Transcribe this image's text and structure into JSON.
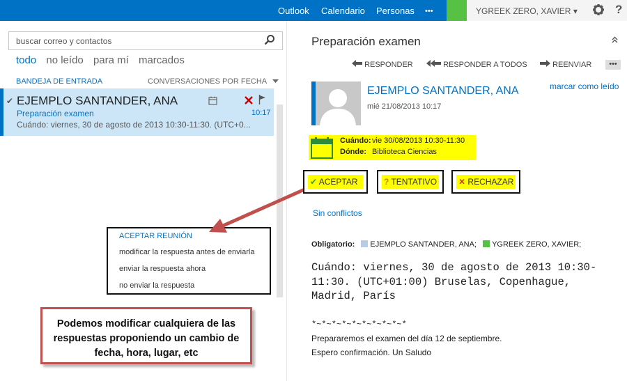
{
  "topbar": {
    "nav": [
      "Outlook",
      "Calendario",
      "Personas"
    ],
    "more": "•••",
    "user": "YGREEK ZERO, XAVIER",
    "user_caret": "▾",
    "icons": [
      "gear-icon",
      "help-icon"
    ],
    "help": "?"
  },
  "search": {
    "placeholder": "buscar correo y contactos"
  },
  "filters": [
    "todo",
    "no leído",
    "para mí",
    "marcados"
  ],
  "folder": {
    "name": "BANDEJA DE ENTRADA",
    "sort": "CONVERSACIONES POR FECHA"
  },
  "message": {
    "sender": "EJEMPLO SANTANDER, ANA",
    "subject": "Preparación examen",
    "preview": "Cuándo: viernes, 30 de agosto de 2013 10:30-11:30. (UTC+0...",
    "time": "10:17"
  },
  "popup": {
    "header": "ACEPTAR REUNIÓN",
    "items": [
      "modificar la respuesta antes de enviarla",
      "enviar la respuesta ahora",
      "no enviar la respuesta"
    ]
  },
  "callout": {
    "lines": [
      "Podemos modificar cualquiera de las",
      "respuestas proponiendo un cambio de",
      "fecha, hora, lugar, etc"
    ]
  },
  "reading": {
    "title": "Preparación examen",
    "actions": [
      "RESPONDER",
      "RESPONDER A TODOS",
      "REENVIAR"
    ],
    "more": "•••",
    "sender": "EJEMPLO SANTANDER, ANA",
    "date": "mié 21/08/2013 10:17",
    "mark_read": "marcar como leído",
    "when_label": "Cuándo:",
    "when_value": "vie 30/08/2013 10:30-11:30",
    "where_label": "Dónde:",
    "where_value": "Biblioteca Ciencias",
    "responses": [
      "ACEPTAR",
      "TENTATIVO",
      "RECHAZAR"
    ],
    "no_conflicts": "Sin conflictos",
    "required_label": "Obligatorio:",
    "attendees": [
      {
        "name": "EJEMPLO SANTANDER, ANA;",
        "color": "#b8cce4"
      },
      {
        "name": "YGREEK ZERO, XAVIER;",
        "color": "#57c143"
      }
    ],
    "body_mono": [
      "Cuándo: viernes, 30 de agosto de 2013 10:30-",
      "11:30. (UTC+01:00) Bruselas, Copenhague,",
      "Madrid, París"
    ],
    "separator": "*~*~*~*~*~*~*~*~*~*",
    "body": [
      "Prepararemos el examen del día 12 de septiembre.",
      "Espero confirmación. Un Saludo"
    ]
  },
  "colors": {
    "brand": "#0072c6",
    "highlight": "#ffff00",
    "callout_border": "#c0504d",
    "presence": "#57c143"
  }
}
